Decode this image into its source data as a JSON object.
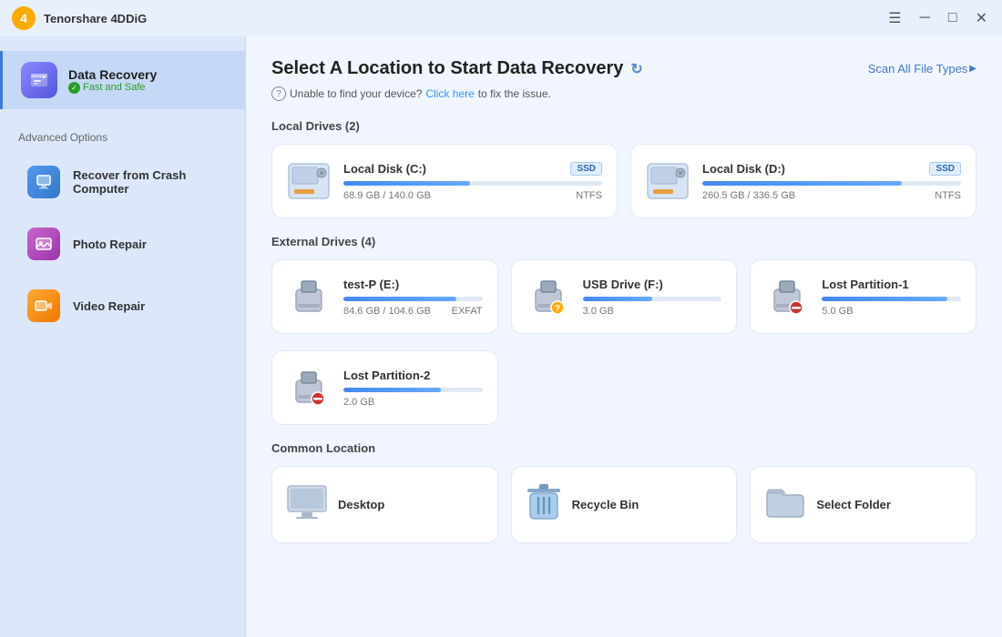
{
  "titlebar": {
    "app_name": "Tenorshare 4DDiG",
    "controls": [
      "menu",
      "minimize",
      "maximize",
      "close"
    ]
  },
  "sidebar": {
    "main_item": {
      "title": "Data Recovery",
      "subtitle": "Fast and Safe"
    },
    "advanced_options_label": "Advanced Options",
    "items": [
      {
        "id": "crash",
        "label": "Recover from Crash Computer",
        "icon": "💻"
      },
      {
        "id": "photo",
        "label": "Photo Repair",
        "icon": "🖼"
      },
      {
        "id": "video",
        "label": "Video Repair",
        "icon": "🎬"
      }
    ]
  },
  "main": {
    "page_title": "Select A Location to Start Data Recovery",
    "scan_all_label": "Scan All File Types",
    "help_text": "Unable to find your device?",
    "help_link": "Click here",
    "help_suffix": "to fix the issue.",
    "local_drives_label": "Local Drives (2)",
    "external_drives_label": "External Drives (4)",
    "common_location_label": "Common Location",
    "local_drives": [
      {
        "name": "Local Disk (C:)",
        "badge": "SSD",
        "used": 68.9,
        "total": 140.0,
        "fs": "NTFS",
        "pct": 49
      },
      {
        "name": "Local Disk (D:)",
        "badge": "SSD",
        "used": 260.5,
        "total": 336.5,
        "fs": "NTFS",
        "pct": 77
      }
    ],
    "external_drives": [
      {
        "name": "test-P (E:)",
        "badge": "",
        "used": 84.6,
        "total": 104.6,
        "fs": "EXFAT",
        "pct": 81,
        "type": "usb",
        "badge_type": "none"
      },
      {
        "name": "USB Drive (F:)",
        "badge": "",
        "used": 3.0,
        "total": null,
        "fs": "",
        "pct": 50,
        "type": "usb",
        "badge_type": "warning"
      },
      {
        "name": "Lost Partition-1",
        "badge": "",
        "used": 5.0,
        "total": null,
        "fs": "",
        "pct": 90,
        "type": "usb",
        "badge_type": "minus"
      },
      {
        "name": "Lost Partition-2",
        "badge": "",
        "used": 2.0,
        "total": null,
        "fs": "",
        "pct": 70,
        "type": "usb",
        "badge_type": "minus"
      }
    ],
    "common_locations": [
      {
        "id": "desktop",
        "label": "Desktop",
        "icon": "desktop"
      },
      {
        "id": "recycle",
        "label": "Recycle Bin",
        "icon": "bin"
      },
      {
        "id": "folder",
        "label": "Select Folder",
        "icon": "folder"
      }
    ]
  }
}
